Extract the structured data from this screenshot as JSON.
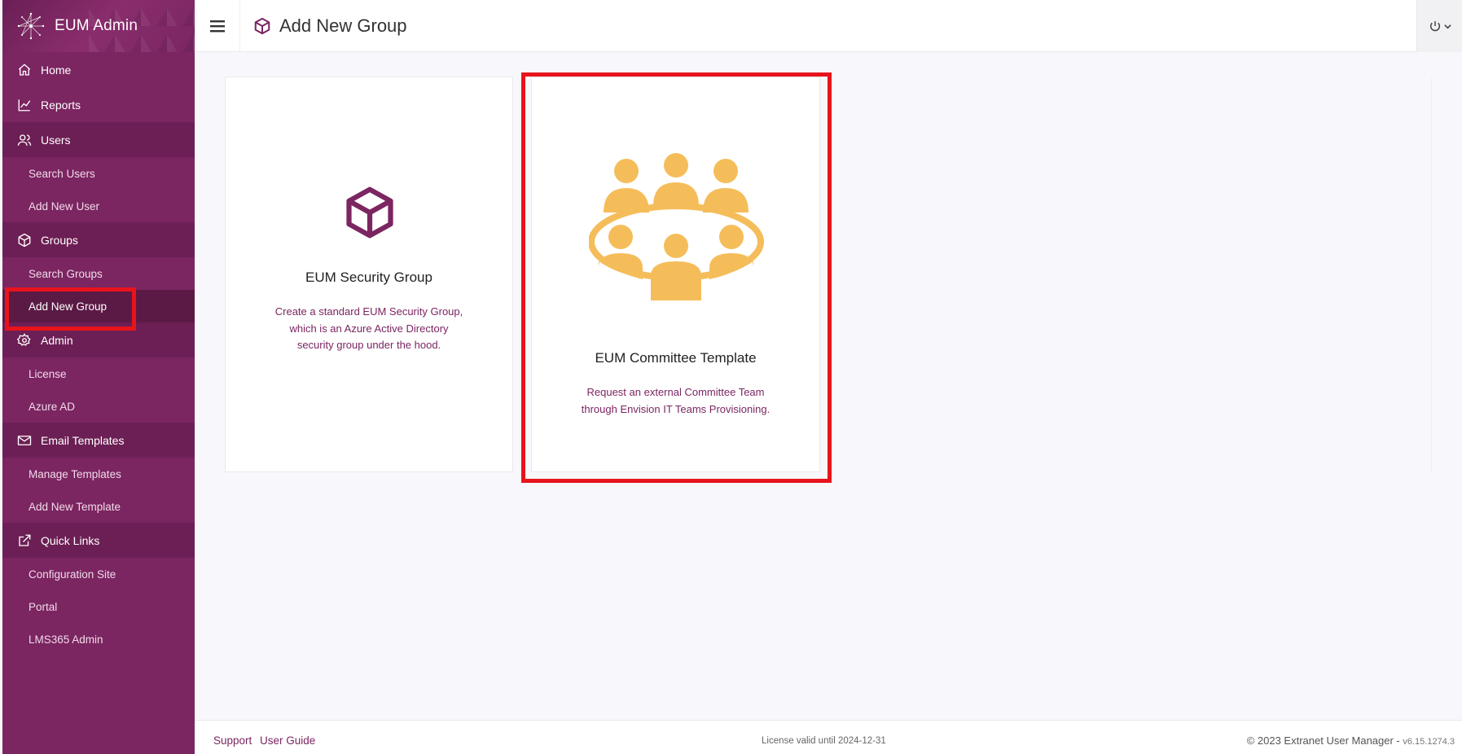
{
  "app": {
    "title": "EUM Admin"
  },
  "header": {
    "page_title": "Add New Group"
  },
  "sidebar": {
    "sections": [
      {
        "label": "Home"
      },
      {
        "label": "Reports"
      },
      {
        "label": "Users",
        "items": [
          {
            "label": "Search Users"
          },
          {
            "label": "Add New User"
          }
        ]
      },
      {
        "label": "Groups",
        "items": [
          {
            "label": "Search Groups"
          },
          {
            "label": "Add New Group"
          }
        ]
      },
      {
        "label": "Admin",
        "items": [
          {
            "label": "License"
          },
          {
            "label": "Azure AD"
          }
        ]
      },
      {
        "label": "Email Templates",
        "items": [
          {
            "label": "Manage Templates"
          },
          {
            "label": "Add New Template"
          }
        ]
      },
      {
        "label": "Quick Links",
        "items": [
          {
            "label": "Configuration Site"
          },
          {
            "label": "Portal"
          },
          {
            "label": "LMS365 Admin"
          }
        ]
      }
    ]
  },
  "cards": [
    {
      "title": "EUM Security Group",
      "desc_lines": [
        "Create a standard EUM Security Group,",
        "which is an Azure Active Directory",
        "security group under the hood."
      ]
    },
    {
      "title": "EUM Committee Template",
      "desc_lines": [
        "Request an external Committee Team",
        "through Envision IT Teams Provisioning."
      ]
    }
  ],
  "footer": {
    "support": "Support",
    "user_guide": "User Guide",
    "license": "License valid until 2024-12-31",
    "copyright": "© 2023 Extranet User Manager - ",
    "version": "v6.15.1274.3"
  },
  "colors": {
    "sidebar": "#7b2561",
    "accent": "#7b2561",
    "committee_icon": "#f5bd5a",
    "highlight": "#e8141c"
  }
}
